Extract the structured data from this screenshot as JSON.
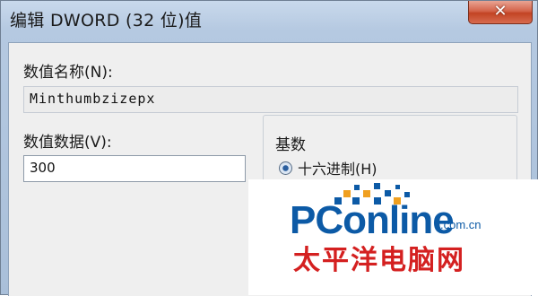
{
  "dialog": {
    "title": "编辑 DWORD (32 位)值",
    "close_glyph": "✕",
    "value_name_label": "数值名称(N):",
    "value_name": "Minthumbzizepx",
    "value_data_label": "数值数据(V):",
    "value_data": "300",
    "base_group_label": "基数",
    "base_options": [
      {
        "label": "十六进制(H)",
        "selected": true
      }
    ]
  },
  "watermark": {
    "brand": "PConline",
    "domain": ".com.cn",
    "chinese": "太平洋电脑网",
    "brand_color": "#0c5aa6",
    "chinese_color": "#d42020",
    "accent_color": "#f0a020"
  },
  "colors": {
    "close_button": "#c24424",
    "dialog_bg": "#efefef"
  }
}
